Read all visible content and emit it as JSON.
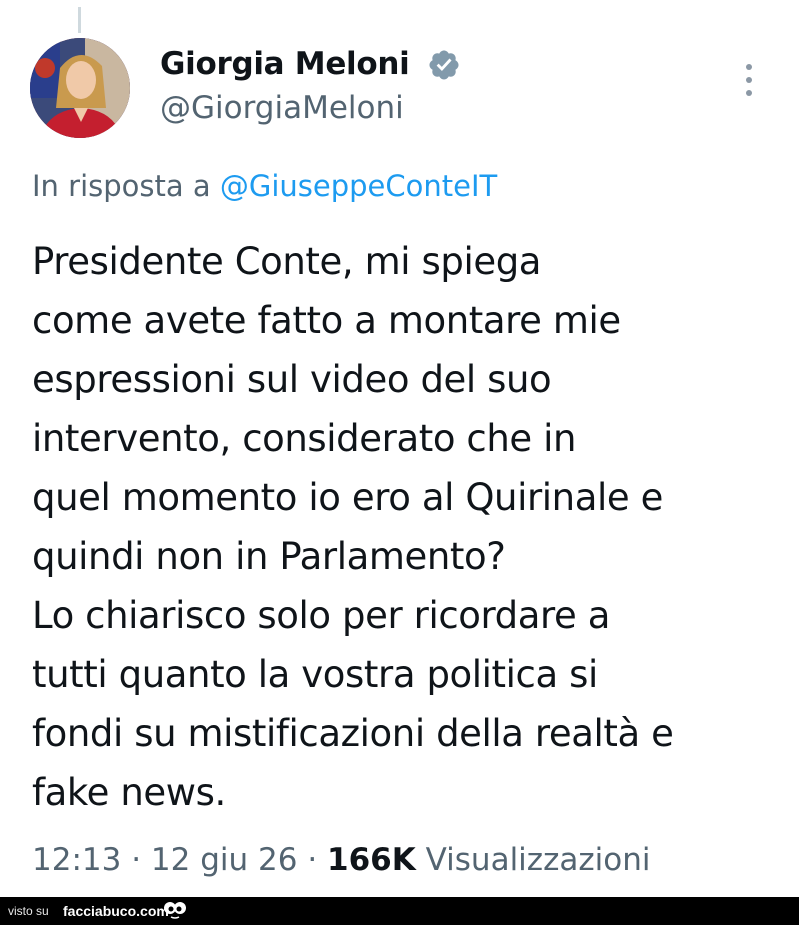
{
  "author": {
    "display_name": "Giorgia Meloni",
    "handle": "@GiorgiaMeloni",
    "verified_icon": "verified-badge-icon"
  },
  "reply": {
    "prefix": "In risposta a",
    "mention": "@GiuseppeConteIT"
  },
  "tweet": {
    "text": "Presidente Conte, mi spiega\ncome avete fatto a montare mie\nespressioni sul video del suo\nintervento, considerato che in\nquel momento io ero al Quirinale e\nquindi non in Parlamento?\nLo chiarisco solo per ricordare a\ntutti quanto la vostra politica si\nfondi su mistificazioni della realtà e\nfake news."
  },
  "meta": {
    "time": "12:13",
    "separator": "·",
    "date": "12 giu 26",
    "views_count": "166K",
    "views_label": "Visualizzazioni"
  },
  "footer": {
    "seen_on": "visto su",
    "site": "facciabuco.com"
  },
  "colors": {
    "link": "#1d9bf0",
    "secondary_text": "#536471",
    "primary_text": "#0f1419",
    "footer_bg": "#000000"
  }
}
